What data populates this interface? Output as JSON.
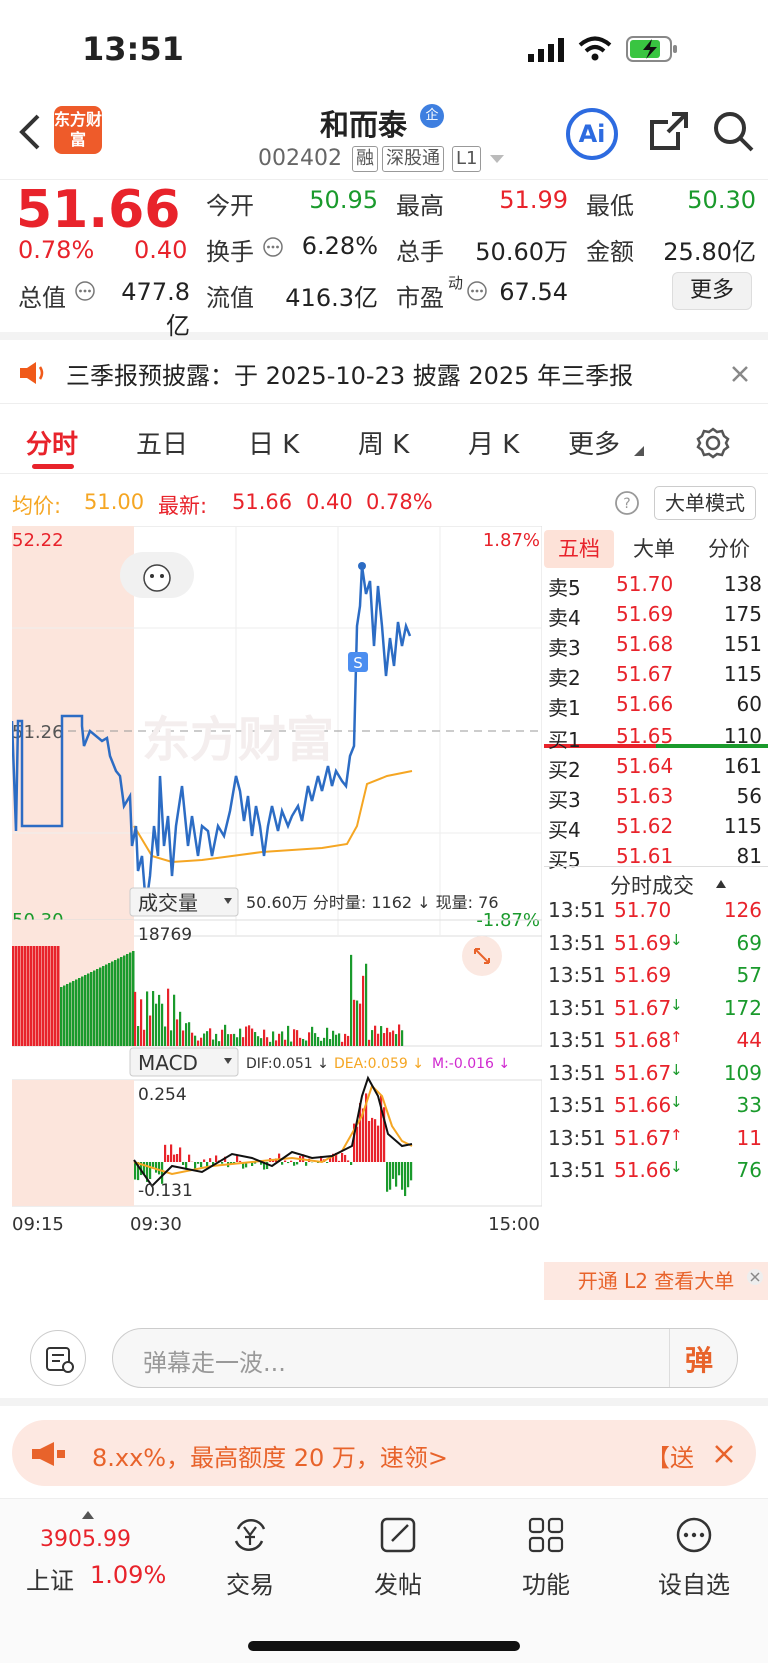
{
  "status": {
    "time": "13:51"
  },
  "header": {
    "name": "和而泰",
    "badge": "企",
    "code": "002402",
    "tags": [
      "融",
      "深股通",
      "L1"
    ],
    "logo_text": "东方财富",
    "ai": "Ai"
  },
  "quote": {
    "price": "51.66",
    "pct": "0.78%",
    "chg": "0.40",
    "open_label": "今开",
    "open": "50.95",
    "high_label": "最高",
    "high": "51.99",
    "low_label": "最低",
    "low": "50.30",
    "turnover_label": "换手",
    "turnover": "6.28%",
    "vol_label": "总手",
    "vol": "50.60万",
    "amt_label": "金额",
    "amt": "25.80亿",
    "mktcap_label": "总值",
    "mktcap": "477.8亿",
    "float_label": "流值",
    "float": "416.3亿",
    "pe_label": "市盈",
    "pe_sup": "动",
    "pe": "67.54",
    "more": "更多"
  },
  "notice": {
    "text": "三季报预披露：于 2025-10-23 披露 2025 年三季报"
  },
  "tabs": [
    "分时",
    "五日",
    "日 K",
    "周 K",
    "月 K",
    "更多"
  ],
  "avgline": {
    "avg_label": "均价:",
    "avg": "51.00",
    "latest_label": "最新:",
    "latest": "51.66",
    "chg": "0.40",
    "pct": "0.78%",
    "mode_btn": "大单模式"
  },
  "chart": {
    "y_high": "52.22",
    "y_mid": "51.26",
    "y_low": "50.30",
    "pct_high": "1.87%",
    "pct_low": "-1.87%",
    "watermark": "东方财富",
    "vol_select": "成交量",
    "vol_info": "50.60万  分时量: 1162 ↓ 现量: 76",
    "vol_max": "18769",
    "macd_select": "MACD",
    "dif": "DIF:0.051 ↓",
    "dea": "DEA:0.059 ↓",
    "m": "M:-0.016 ↓",
    "macd_high": "0.254",
    "macd_low": "-0.131",
    "t_start": "09:15",
    "t_open": "09:30",
    "t_end": "15:00",
    "s_marker": "S"
  },
  "book": {
    "tabs": [
      "五档",
      "大单",
      "分价"
    ],
    "asks": [
      [
        "卖5",
        "51.70",
        "138"
      ],
      [
        "卖4",
        "51.69",
        "175"
      ],
      [
        "卖3",
        "51.68",
        "151"
      ],
      [
        "卖2",
        "51.67",
        "115"
      ],
      [
        "卖1",
        "51.66",
        "60"
      ]
    ],
    "bids": [
      [
        "买1",
        "51.65",
        "110"
      ],
      [
        "买2",
        "51.64",
        "161"
      ],
      [
        "买3",
        "51.63",
        "56"
      ],
      [
        "买4",
        "51.62",
        "115"
      ],
      [
        "买5",
        "51.61",
        "81"
      ]
    ],
    "ticks_title": "分时成交",
    "ticks": [
      [
        "13:51",
        "51.70",
        "",
        "126",
        "red"
      ],
      [
        "13:51",
        "51.69",
        "↓",
        "69",
        "green"
      ],
      [
        "13:51",
        "51.69",
        "",
        "57",
        "green"
      ],
      [
        "13:51",
        "51.67",
        "↓",
        "172",
        "green"
      ],
      [
        "13:51",
        "51.68",
        "↑",
        "44",
        "red"
      ],
      [
        "13:51",
        "51.67",
        "↓",
        "109",
        "green"
      ],
      [
        "13:51",
        "51.66",
        "↓",
        "33",
        "green"
      ],
      [
        "13:51",
        "51.67",
        "↑",
        "11",
        "red"
      ],
      [
        "13:51",
        "51.66",
        "↓",
        "76",
        "green"
      ]
    ],
    "l2": "开通 L2 查看大单"
  },
  "danmu": {
    "placeholder": "弹幕走一波...",
    "btn": "弹"
  },
  "ad": {
    "text": "8.xx%，最高额度 20 万，速领>",
    "right": "【送"
  },
  "bottomnav": {
    "index_value": "3905.99",
    "index_name": "上证",
    "index_pct": "1.09%",
    "items": [
      "交易",
      "发帖",
      "功能",
      "设自选"
    ]
  },
  "colors": {
    "red": "#e8232b",
    "green": "#1a9a2c",
    "blue": "#2c6cc4",
    "orange": "#f5a623"
  }
}
